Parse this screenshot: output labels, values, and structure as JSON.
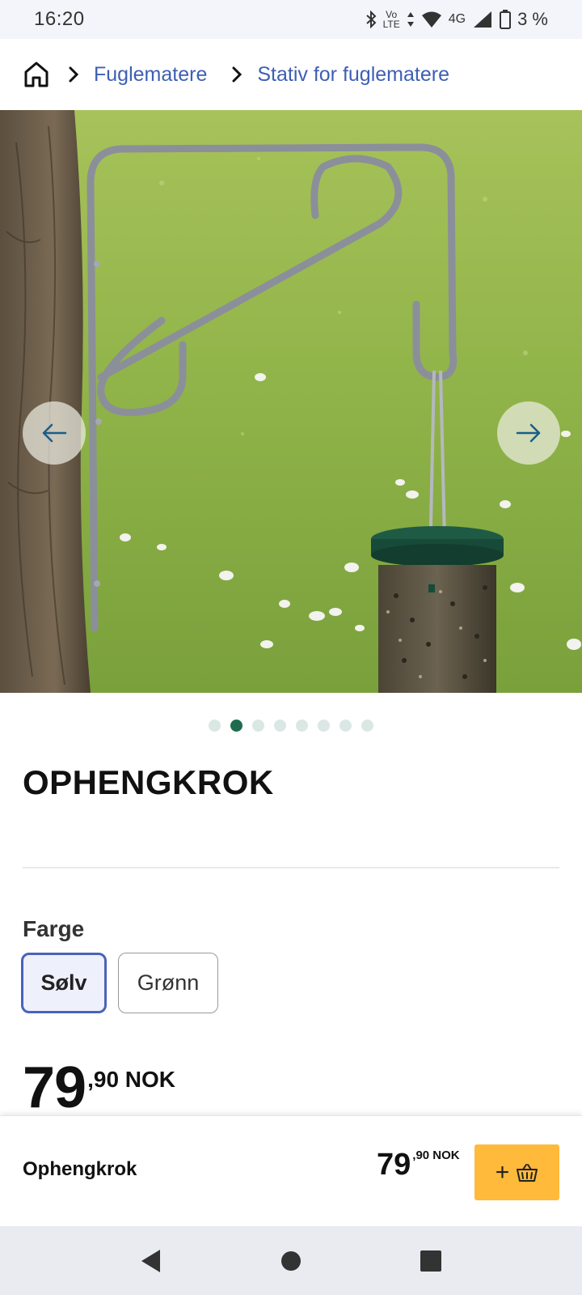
{
  "status_bar": {
    "time": "16:20",
    "volte_top": "Vo",
    "volte_bottom": "LTE",
    "network": "4G",
    "battery": "3 %"
  },
  "breadcrumb": {
    "home_icon": "home-icon",
    "items": [
      {
        "label": "Fuglematere"
      },
      {
        "label": "Stativ for fuglematere"
      }
    ]
  },
  "gallery": {
    "image_count": 8,
    "active_index": 1,
    "prev_icon": "arrow-left-icon",
    "next_icon": "arrow-right-icon"
  },
  "product": {
    "title": "OPHENGKROK",
    "color_label": "Farge",
    "color_options": [
      {
        "label": "Sølv",
        "selected": true
      },
      {
        "label": "Grønn",
        "selected": false
      }
    ],
    "price_int": "79",
    "price_dec": ",90 NOK"
  },
  "sticky_bar": {
    "name": "Ophengkrok",
    "price_int": "79",
    "price_dec": ",90 NOK",
    "add_label": "+",
    "basket_icon": "basket-icon"
  },
  "colors": {
    "link": "#3d5fb5",
    "accent_green": "#1f6b4f",
    "add_button": "#ffb93b",
    "selected_border": "#4a63b8"
  }
}
